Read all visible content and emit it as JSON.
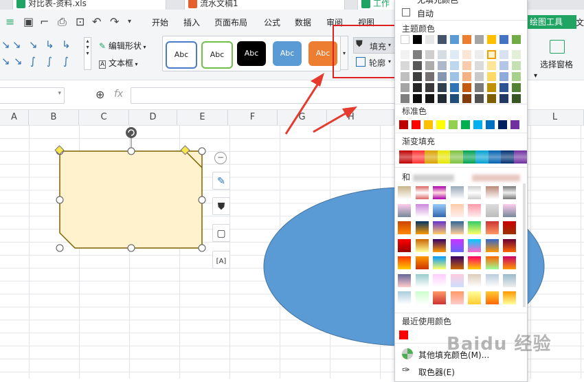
{
  "tabs": {
    "tab1": "对比表-资料.xls",
    "tab2": "流水文稿1",
    "tab3": "工作"
  },
  "menu": {
    "items": [
      "开始",
      "插入",
      "页面布局",
      "公式",
      "数据",
      "审阅",
      "视图"
    ],
    "draw_tool": "绘图工具",
    "right_cut": "文"
  },
  "ribbon": {
    "edit_shape": "编辑形状",
    "text_box": "文本框",
    "style_sample": "Abc",
    "fill": "填充",
    "outline": "轮廓",
    "select_pane": "选择窗格"
  },
  "formula": {
    "fx": "fx"
  },
  "columns": [
    "A",
    "B",
    "C",
    "D",
    "E",
    "F",
    "G",
    "H",
    "L"
  ],
  "dropdown": {
    "no_fill_partial": "无填充颜色",
    "auto": "自动",
    "theme_colors": "主题颜色",
    "standard_colors": "标准色",
    "gradient_fill": "渐变填充",
    "more_prefix": "和",
    "recent_colors": "最近使用颜色",
    "other_fill": "其他填充颜色(M)...",
    "eyedropper": "取色器(E)",
    "standard_list": [
      "#c00000",
      "#ff0000",
      "#ffc000",
      "#ffff00",
      "#92d050",
      "#00b050",
      "#00b0f0",
      "#0070c0",
      "#002060",
      "#7030a0"
    ],
    "gradient_list": [
      "#c00000",
      "#ff3030",
      "#d9a000",
      "#e6e600",
      "#7cc040",
      "#00a050",
      "#00a0d0",
      "#0060b0",
      "#003070",
      "#7030a0"
    ],
    "recent_list": [
      "#ff0000"
    ],
    "theme_top": [
      "#ffffff",
      "#000000",
      "#e7e6e6",
      "#44546a",
      "#5b9bd5",
      "#ed7d31",
      "#a5a5a5",
      "#ffc000",
      "#4472c4",
      "#70ad47"
    ]
  },
  "watermark": "Baidu 经验",
  "colors": {
    "shape_fill": "#fff2cc",
    "shape_stroke": "#7f6000",
    "ellipse": "#5b9bd5",
    "arrow": "#e63a2e",
    "accent": "#1fa463"
  }
}
